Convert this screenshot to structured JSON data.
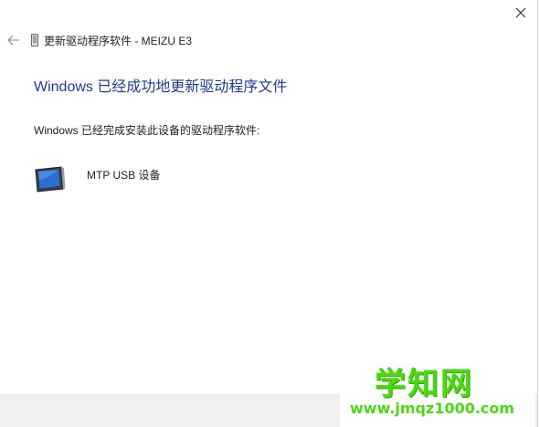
{
  "window": {
    "title": "更新驱动程序软件 - MEIZU E3",
    "icons": {
      "back": "back-arrow-icon",
      "close": "close-icon",
      "device": "phone-device-icon",
      "tablet": "tablet-device-icon"
    }
  },
  "content": {
    "heading": "Windows 已经成功地更新驱动程序文件",
    "subtext": "Windows 已经完成安装此设备的驱动程序软件:",
    "device_name": "MTP USB 设备"
  },
  "watermark": {
    "text": "学知网",
    "url": "www.jmqz1000.com"
  },
  "colors": {
    "heading": "#1f3c8c",
    "watermark": "#4cd812",
    "footer": "#f0f0f0"
  }
}
